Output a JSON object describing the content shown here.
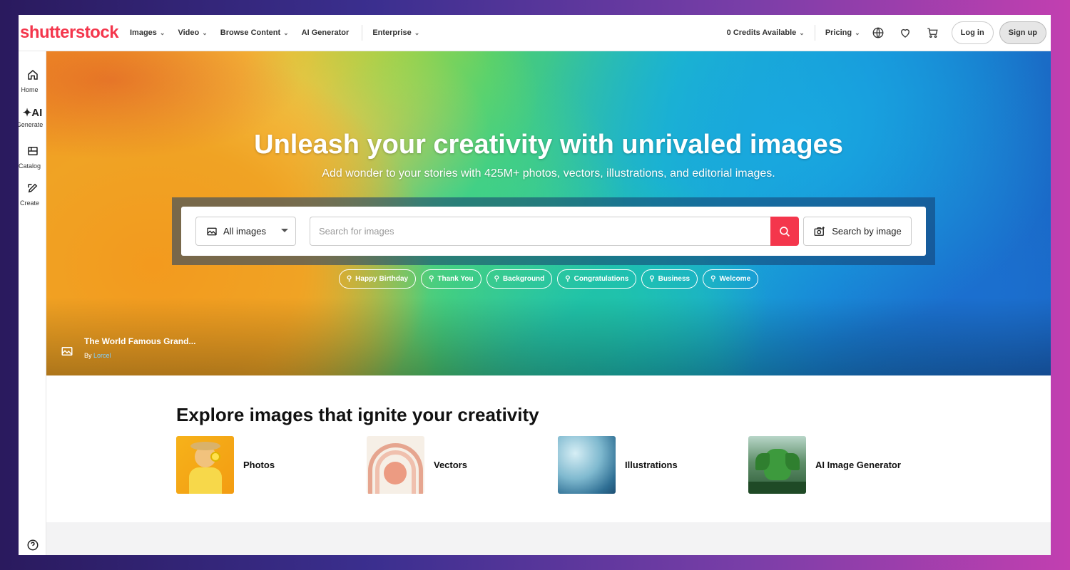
{
  "brand": {
    "logo_text": "shutterstock",
    "accent": "#f4364c"
  },
  "nav": {
    "items": [
      {
        "label": "Images",
        "dropdown": true
      },
      {
        "label": "Video",
        "dropdown": true
      },
      {
        "label": "Browse Content",
        "dropdown": true
      },
      {
        "label": "AI Generator",
        "dropdown": false
      },
      {
        "label": "Enterprise",
        "dropdown": true
      }
    ],
    "credits": "0 Credits Available",
    "pricing": "Pricing",
    "login": "Log in",
    "signup": "Sign up"
  },
  "rail": {
    "items": [
      {
        "label": "Home",
        "icon": "home-icon"
      },
      {
        "label": "Generate",
        "icon": "ai-sparkle-icon"
      },
      {
        "label": "Catalog",
        "icon": "catalog-icon"
      },
      {
        "label": "Create",
        "icon": "create-icon"
      }
    ],
    "help": "Help"
  },
  "hero": {
    "title": "Unleash your creativity with unrivaled images",
    "subtitle": "Add wonder to your stories with 425M+ photos, vectors, illustrations, and editorial images.",
    "search": {
      "type_selected": "All images",
      "placeholder": "Search for images",
      "search_by_image": "Search by image"
    },
    "chips": [
      "Happy Birthday",
      "Thank You",
      "Background",
      "Congratulations",
      "Business",
      "Welcome"
    ],
    "credit": {
      "title": "The World Famous Grand...",
      "by": "By",
      "author": "Lorcel"
    }
  },
  "explore": {
    "title": "Explore images that ignite your creativity",
    "categories": [
      {
        "label": "Photos"
      },
      {
        "label": "Vectors"
      },
      {
        "label": "Illustrations"
      },
      {
        "label": "AI Image Generator"
      }
    ]
  }
}
